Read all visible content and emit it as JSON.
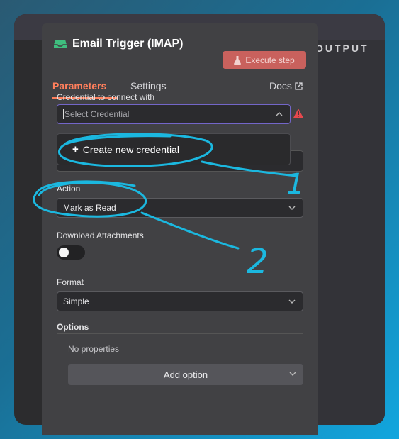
{
  "header": {
    "title": "Email Trigger (IMAP)",
    "execute_label": "Execute step",
    "icon": "inbox-icon",
    "trigger_icon_color": "#3fbf7f"
  },
  "tabs": {
    "parameters": "Parameters",
    "settings": "Settings",
    "docs": "Docs"
  },
  "output_pane": {
    "label": "OUTPUT"
  },
  "credential": {
    "label": "Credential to connect with",
    "placeholder": "Select Credential",
    "warning_icon": "warning-icon"
  },
  "dropdown": {
    "create_label": "Create new credential"
  },
  "action": {
    "label": "Action",
    "value": "Mark as Read"
  },
  "download": {
    "label": "Download Attachments",
    "enabled": false
  },
  "format": {
    "label": "Format",
    "value": "Simple"
  },
  "options": {
    "label": "Options",
    "empty_text": "No properties",
    "add_label": "Add option"
  },
  "annotations": {
    "step1": "1",
    "step2": "2",
    "color": "#1bb8e0"
  },
  "colors": {
    "accent": "#ff7f5c",
    "execute_button": "#c9615d",
    "focus_border": "#7366c9",
    "warning": "#e5484d"
  }
}
